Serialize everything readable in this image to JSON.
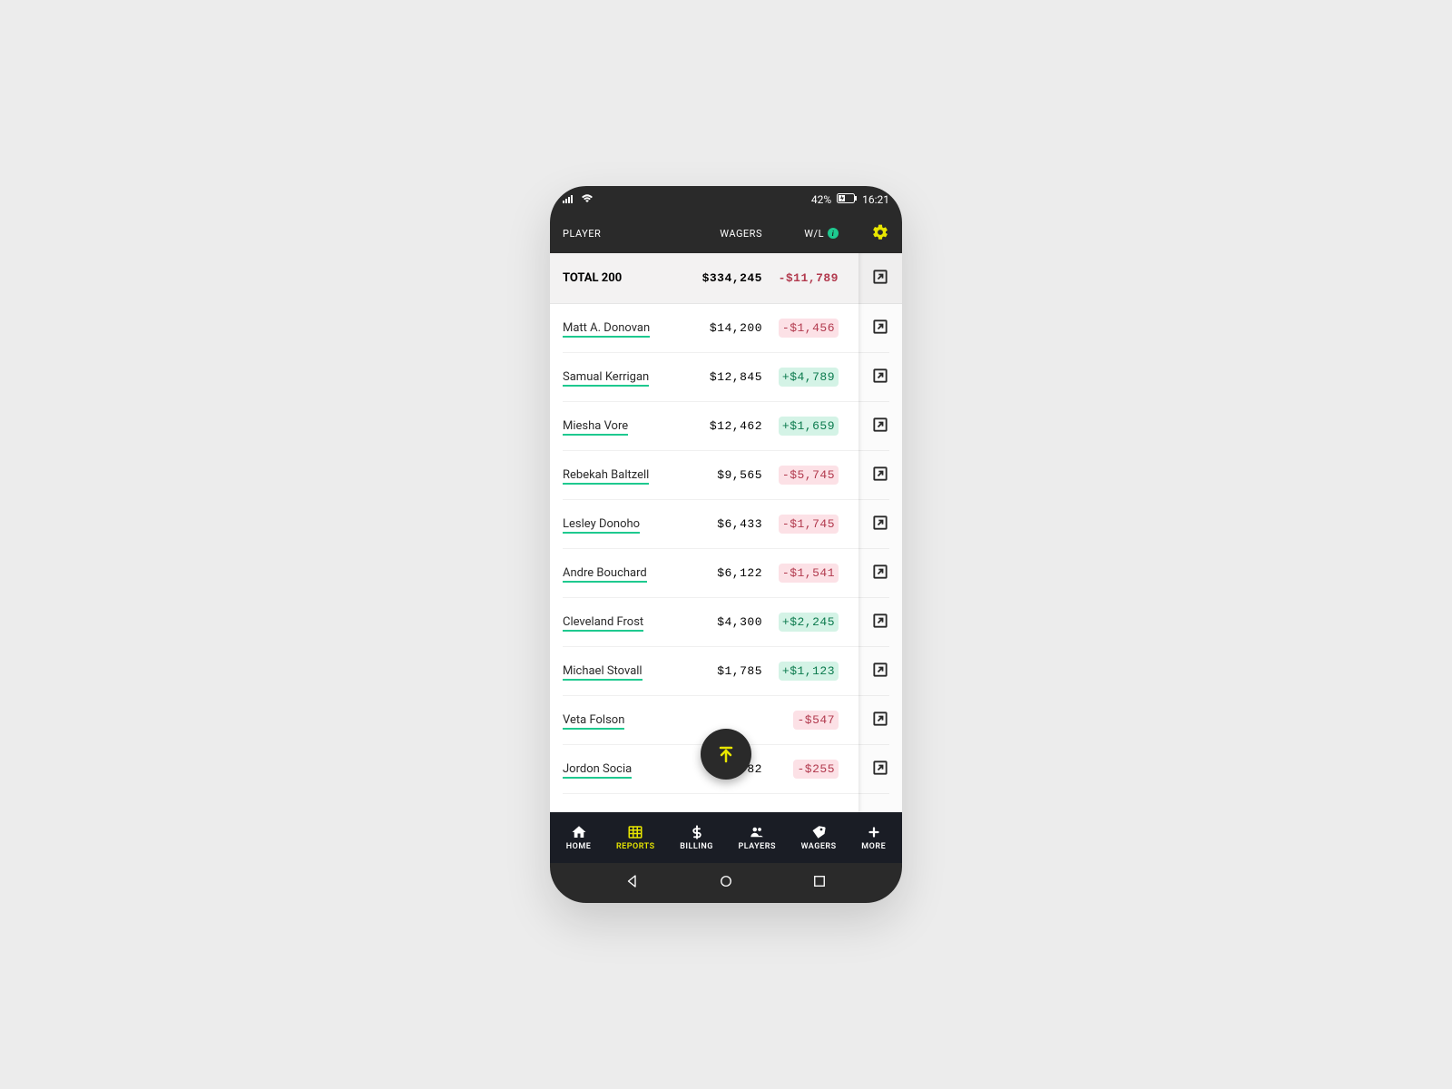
{
  "status": {
    "battery": "42%",
    "time": "16:21"
  },
  "header": {
    "player": "PLAYER",
    "wagers": "WAGERS",
    "wl": "W/L"
  },
  "total": {
    "label": "TOTAL 200",
    "wagers": "$334,245",
    "wl": "-$11,789"
  },
  "players": [
    {
      "name": "Matt A. Donovan",
      "wagers": "$14,200",
      "wl": "-$1,456",
      "wl_sign": "neg"
    },
    {
      "name": "Samual Kerrigan",
      "wagers": "$12,845",
      "wl": "+$4,789",
      "wl_sign": "pos"
    },
    {
      "name": "Miesha Vore",
      "wagers": "$12,462",
      "wl": "+$1,659",
      "wl_sign": "pos"
    },
    {
      "name": "Rebekah Baltzell",
      "wagers": "$9,565",
      "wl": "-$5,745",
      "wl_sign": "neg"
    },
    {
      "name": "Lesley Donoho",
      "wagers": "$6,433",
      "wl": "-$1,745",
      "wl_sign": "neg"
    },
    {
      "name": "Andre Bouchard",
      "wagers": "$6,122",
      "wl": "-$1,541",
      "wl_sign": "neg"
    },
    {
      "name": "Cleveland Frost",
      "wagers": "$4,300",
      "wl": "+$2,245",
      "wl_sign": "pos"
    },
    {
      "name": "Michael Stovall",
      "wagers": "$1,785",
      "wl": "+$1,123",
      "wl_sign": "pos"
    },
    {
      "name": "Veta Folson",
      "wagers": "",
      "wl": "-$547",
      "wl_sign": "neg"
    },
    {
      "name": "Jordon Socia",
      "wagers": "$782",
      "wl": "-$255",
      "wl_sign": "neg"
    }
  ],
  "nav": {
    "home": "HOME",
    "reports": "REPORTS",
    "billing": "BILLING",
    "players": "PLAYERS",
    "wagers": "WAGERS",
    "more": "MORE"
  }
}
